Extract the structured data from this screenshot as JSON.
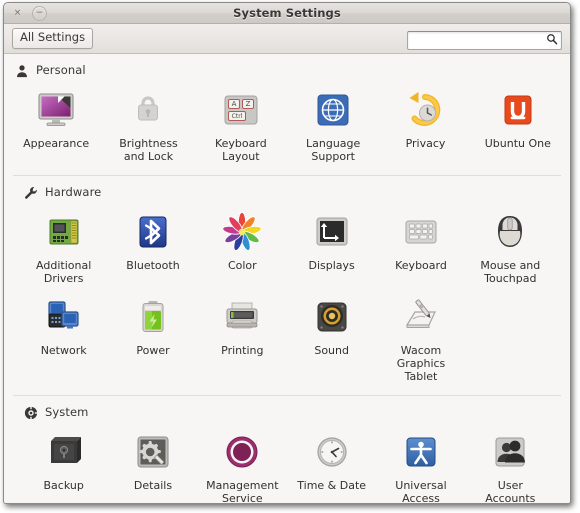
{
  "window": {
    "title": "System Settings",
    "close_label": "×",
    "minimize_label": "−",
    "close_icon": "close-icon",
    "minimize_icon": "minimize-icon"
  },
  "toolbar": {
    "all_settings_label": "All Settings",
    "search_value": "",
    "search_placeholder": "",
    "search_icon": "search-icon"
  },
  "colors": {
    "window_bg": "#f7f6f5",
    "titlebar": "#dcd9d5",
    "text": "#33312f",
    "ubuntu_orange": "#dd4814",
    "management_purple": "#932d6d",
    "accessibility_blue": "#3465a4",
    "bluetooth_blue": "#2c4b9e",
    "power_green": "#73d216"
  },
  "sections": [
    {
      "title": "Personal",
      "icon": "person-icon",
      "items": [
        {
          "label": "Appearance",
          "icon": "appearance-icon"
        },
        {
          "label": "Brightness\nand Lock",
          "icon": "brightness-and-lock-icon"
        },
        {
          "label": "Keyboard\nLayout",
          "icon": "keyboard-layout-icon"
        },
        {
          "label": "Language\nSupport",
          "icon": "language-support-icon"
        },
        {
          "label": "Privacy",
          "icon": "privacy-icon"
        },
        {
          "label": "Ubuntu One",
          "icon": "ubuntu-one-icon"
        }
      ]
    },
    {
      "title": "Hardware",
      "icon": "wrench-icon",
      "items": [
        {
          "label": "Additional\nDrivers",
          "icon": "additional-drivers-icon"
        },
        {
          "label": "Bluetooth",
          "icon": "bluetooth-icon"
        },
        {
          "label": "Color",
          "icon": "color-icon"
        },
        {
          "label": "Displays",
          "icon": "displays-icon"
        },
        {
          "label": "Keyboard",
          "icon": "keyboard-icon"
        },
        {
          "label": "Mouse and\nTouchpad",
          "icon": "mouse-and-touchpad-icon"
        },
        {
          "label": "Network",
          "icon": "network-icon"
        },
        {
          "label": "Power",
          "icon": "power-icon"
        },
        {
          "label": "Printing",
          "icon": "printing-icon"
        },
        {
          "label": "Sound",
          "icon": "sound-icon"
        },
        {
          "label": "Wacom\nGraphics\nTablet",
          "icon": "wacom-graphics-tablet-icon"
        }
      ]
    },
    {
      "title": "System",
      "icon": "system-gear-icon",
      "items": [
        {
          "label": "Backup",
          "icon": "backup-icon"
        },
        {
          "label": "Details",
          "icon": "details-icon"
        },
        {
          "label": "Management\nService",
          "icon": "management-service-icon"
        },
        {
          "label": "Time & Date",
          "icon": "time-and-date-icon"
        },
        {
          "label": "Universal\nAccess",
          "icon": "universal-access-icon"
        },
        {
          "label": "User\nAccounts",
          "icon": "user-accounts-icon"
        }
      ]
    }
  ]
}
